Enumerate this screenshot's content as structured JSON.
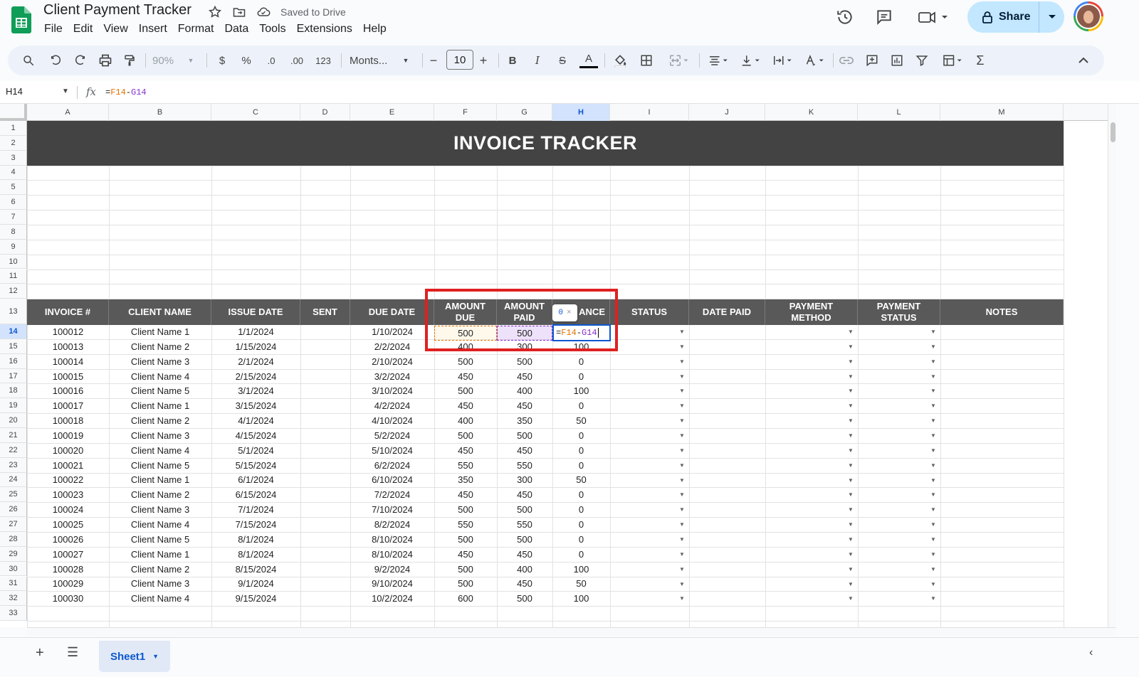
{
  "app": {
    "title": "Client Payment Tracker",
    "saved_status": "Saved to Drive",
    "share_label": "Share"
  },
  "menu": [
    "File",
    "Edit",
    "View",
    "Insert",
    "Format",
    "Data",
    "Tools",
    "Extensions",
    "Help"
  ],
  "toolbar": {
    "zoom": "90%",
    "currency": "$",
    "percent": "%",
    "dec_decrease": ".0",
    "dec_increase": ".00",
    "number_format": "123",
    "font": "Monts...",
    "font_size": "10",
    "minus": "−",
    "plus": "+",
    "bold": "B",
    "italic": "I",
    "strike": "S",
    "textcolor": "A"
  },
  "formula_bar": {
    "name_box": "H14",
    "fx": "fx",
    "formula_eq": "=",
    "formula_f": "F14",
    "formula_op": "-",
    "formula_g": "G14"
  },
  "columns": [
    "A",
    "B",
    "C",
    "D",
    "E",
    "F",
    "G",
    "H",
    "I",
    "J",
    "K",
    "L",
    "M"
  ],
  "selected_column": "H",
  "rows": [
    "1",
    "2",
    "3",
    "4",
    "5",
    "6",
    "7",
    "8",
    "9",
    "10",
    "11",
    "12",
    "13",
    "14",
    "15",
    "16",
    "17",
    "18",
    "19",
    "20",
    "21",
    "22",
    "23",
    "24",
    "25",
    "26",
    "27",
    "28",
    "29",
    "30",
    "31",
    "32",
    "33"
  ],
  "selected_row": "14",
  "banner": "INVOICE TRACKER",
  "headers": [
    "INVOICE #",
    "CLIENT NAME",
    "ISSUE DATE",
    "SENT",
    "DUE DATE",
    "AMOUNT DUE",
    "AMOUNT PAID",
    "ANCE",
    "STATUS",
    "DATE PAID",
    "PAYMENT METHOD",
    "PAYMENT STATUS",
    "NOTES"
  ],
  "data_rows": [
    [
      "100012",
      "Client Name 1",
      "1/1/2024",
      "",
      "1/10/2024",
      "500",
      "500",
      ""
    ],
    [
      "100013",
      "Client Name 2",
      "1/15/2024",
      "",
      "2/2/2024",
      "400",
      "300",
      "100"
    ],
    [
      "100014",
      "Client Name 3",
      "2/1/2024",
      "",
      "2/10/2024",
      "500",
      "500",
      "0"
    ],
    [
      "100015",
      "Client Name 4",
      "2/15/2024",
      "",
      "3/2/2024",
      "450",
      "450",
      "0"
    ],
    [
      "100016",
      "Client Name 5",
      "3/1/2024",
      "",
      "3/10/2024",
      "500",
      "400",
      "100"
    ],
    [
      "100017",
      "Client Name 1",
      "3/15/2024",
      "",
      "4/2/2024",
      "450",
      "450",
      "0"
    ],
    [
      "100018",
      "Client Name 2",
      "4/1/2024",
      "",
      "4/10/2024",
      "400",
      "350",
      "50"
    ],
    [
      "100019",
      "Client Name 3",
      "4/15/2024",
      "",
      "5/2/2024",
      "500",
      "500",
      "0"
    ],
    [
      "100020",
      "Client Name 4",
      "5/1/2024",
      "",
      "5/10/2024",
      "450",
      "450",
      "0"
    ],
    [
      "100021",
      "Client Name 5",
      "5/15/2024",
      "",
      "6/2/2024",
      "550",
      "550",
      "0"
    ],
    [
      "100022",
      "Client Name 1",
      "6/1/2024",
      "",
      "6/10/2024",
      "350",
      "300",
      "50"
    ],
    [
      "100023",
      "Client Name 2",
      "6/15/2024",
      "",
      "7/2/2024",
      "450",
      "450",
      "0"
    ],
    [
      "100024",
      "Client Name 3",
      "7/1/2024",
      "",
      "7/10/2024",
      "500",
      "500",
      "0"
    ],
    [
      "100025",
      "Client Name 4",
      "7/15/2024",
      "",
      "8/2/2024",
      "550",
      "550",
      "0"
    ],
    [
      "100026",
      "Client Name 5",
      "8/1/2024",
      "",
      "8/10/2024",
      "500",
      "500",
      "0"
    ],
    [
      "100027",
      "Client Name 1",
      "8/1/2024",
      "",
      "8/10/2024",
      "450",
      "450",
      "0"
    ],
    [
      "100028",
      "Client Name 2",
      "8/15/2024",
      "",
      "9/2/2024",
      "500",
      "400",
      "100"
    ],
    [
      "100029",
      "Client Name 3",
      "9/1/2024",
      "",
      "9/10/2024",
      "500",
      "450",
      "50"
    ],
    [
      "100030",
      "Client Name 4",
      "9/15/2024",
      "",
      "10/2/2024",
      "600",
      "500",
      "100"
    ]
  ],
  "editing_cell": {
    "ref": "H14",
    "eq": "=",
    "f": "F14",
    "op": "-",
    "g": "G14"
  },
  "tooltip": {
    "value": "0",
    "close": "×"
  },
  "sheet_tab": "Sheet1",
  "colors": {
    "banner": "#434343",
    "header": "#595959",
    "accent": "#0b57d0",
    "highlight": "#e02020",
    "share_bg": "#c2e7ff"
  }
}
